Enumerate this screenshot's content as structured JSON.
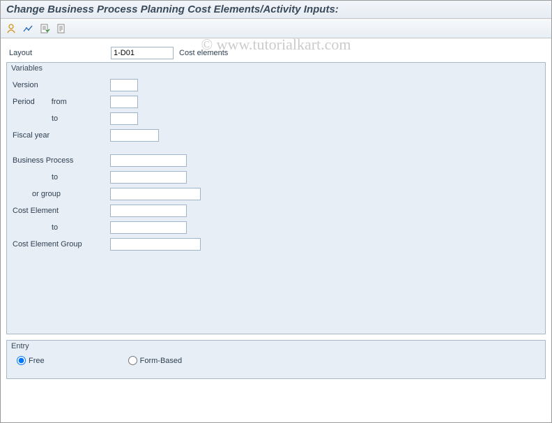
{
  "title": "Change Business Process Planning Cost Elements/Activity Inputs:",
  "watermark": "© www.tutorialkart.com",
  "layout_row": {
    "label": "Layout",
    "value": "1-D01",
    "desc": "Cost elements"
  },
  "variables": {
    "title": "Variables",
    "version_label": "Version",
    "period_label": "Period",
    "from_label": "from",
    "to_label": "to",
    "fiscal_year_label": "Fiscal year",
    "business_process_label": "Business Process",
    "or_group_label": "or group",
    "cost_element_label": "Cost Element",
    "cost_element_group_label": "Cost Element Group",
    "values": {
      "version": "",
      "period_from": "",
      "period_to": "",
      "fiscal_year": "",
      "business_process": "",
      "business_process_to": "",
      "business_process_group": "",
      "cost_element": "",
      "cost_element_to": "",
      "cost_element_group": ""
    }
  },
  "entry": {
    "title": "Entry",
    "free_label": "Free",
    "form_label": "Form-Based",
    "selected": "free"
  }
}
